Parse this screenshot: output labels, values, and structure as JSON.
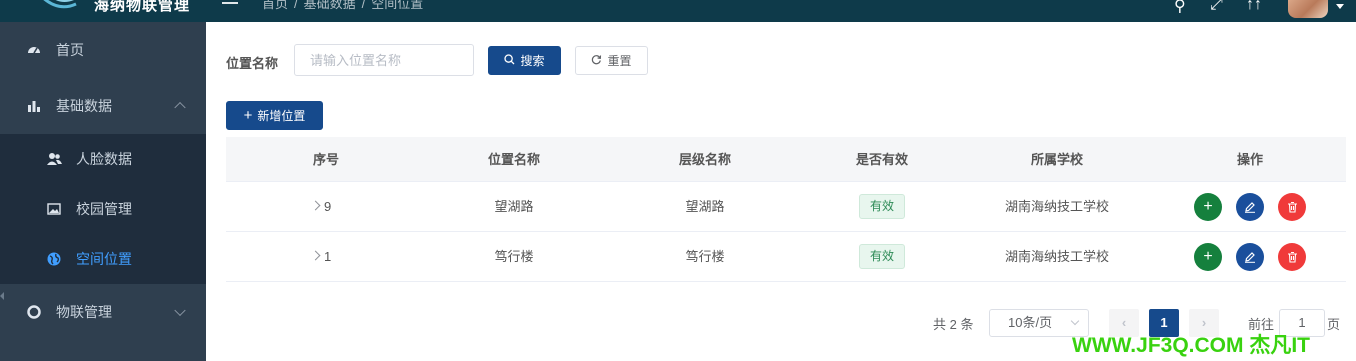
{
  "app": {
    "title": "海纳物联管理"
  },
  "breadcrumb": [
    "首页",
    "/",
    "基础数据",
    "/",
    "空间位置"
  ],
  "sidebar": {
    "items": [
      {
        "label": "首页",
        "icon": "dashboard-icon"
      },
      {
        "label": "基础数据",
        "icon": "bar-chart-icon"
      },
      {
        "label": "人脸数据",
        "icon": "users-icon"
      },
      {
        "label": "校园管理",
        "icon": "picture-icon"
      },
      {
        "label": "空间位置",
        "icon": "globe-icon"
      },
      {
        "label": "物联管理",
        "icon": "lifebuoy-icon"
      }
    ]
  },
  "search": {
    "label": "位置名称",
    "placeholder": "请输入位置名称",
    "search_label": "搜索",
    "reset_label": "重置"
  },
  "toolbar": {
    "add_label": "新增位置"
  },
  "table": {
    "headers": [
      "序号",
      "位置名称",
      "层级名称",
      "是否有效",
      "所属学校",
      "操作"
    ],
    "rows": [
      {
        "index": "9",
        "location": "望湖路",
        "level": "望湖路",
        "valid": "有效",
        "school": "湖南海纳技工学校"
      },
      {
        "index": "1",
        "location": "笃行楼",
        "level": "笃行楼",
        "valid": "有效",
        "school": "湖南海纳技工学校"
      }
    ]
  },
  "pagination": {
    "total": "共 2 条",
    "page_size": "10条/页",
    "current_page": "1",
    "goto_prefix": "前往",
    "goto_value": "1",
    "goto_suffix": "页"
  },
  "watermark": "WWW.JF3Q.COM 杰凡IT",
  "colors": {
    "primary": "#164a8c",
    "sidebar": "#2f3f4f",
    "topbar": "#0e3a4a",
    "active": "#409eff",
    "add": "#15803d",
    "delete": "#f03a3a"
  }
}
